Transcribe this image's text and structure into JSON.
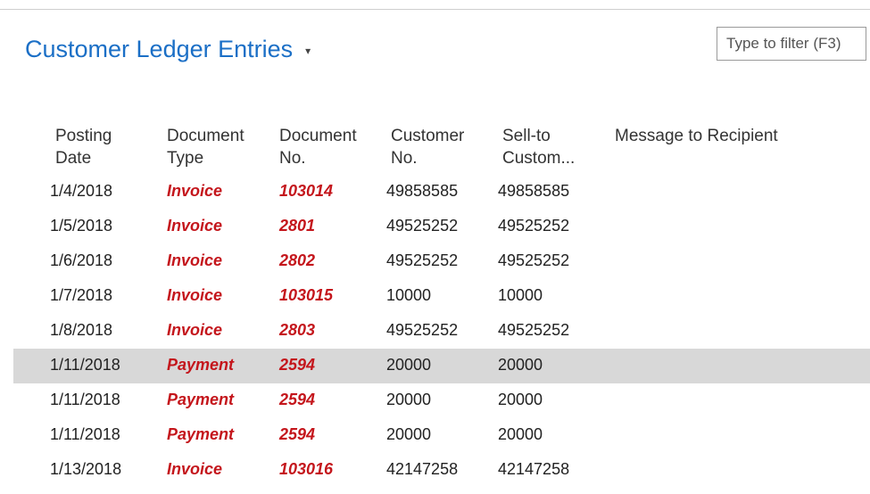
{
  "page": {
    "title": "Customer Ledger Entries",
    "title_dropdown_icon": "chevron-down-icon",
    "filter_placeholder": "Type to filter (F3)"
  },
  "table": {
    "columns": [
      {
        "key": "posting_date",
        "label": "Posting\nDate"
      },
      {
        "key": "document_type",
        "label": "Document\nType"
      },
      {
        "key": "document_no",
        "label": "Document\nNo."
      },
      {
        "key": "customer_no",
        "label": "Customer\nNo."
      },
      {
        "key": "sell_to",
        "label": "Sell-to\nCustom..."
      },
      {
        "key": "message",
        "label": "Message to Recipient"
      }
    ],
    "rows": [
      {
        "posting_date": "1/4/2018",
        "document_type": "Invoice",
        "document_no": "103014",
        "customer_no": "49858585",
        "sell_to": "49858585",
        "message": "",
        "selected": false
      },
      {
        "posting_date": "1/5/2018",
        "document_type": "Invoice",
        "document_no": "2801",
        "customer_no": "49525252",
        "sell_to": "49525252",
        "message": "",
        "selected": false
      },
      {
        "posting_date": "1/6/2018",
        "document_type": "Invoice",
        "document_no": "2802",
        "customer_no": "49525252",
        "sell_to": "49525252",
        "message": "",
        "selected": false
      },
      {
        "posting_date": "1/7/2018",
        "document_type": "Invoice",
        "document_no": "103015",
        "customer_no": "10000",
        "sell_to": "10000",
        "message": "",
        "selected": false
      },
      {
        "posting_date": "1/8/2018",
        "document_type": "Invoice",
        "document_no": "2803",
        "customer_no": "49525252",
        "sell_to": "49525252",
        "message": "",
        "selected": false
      },
      {
        "posting_date": "1/11/2018",
        "document_type": "Payment",
        "document_no": "2594",
        "customer_no": "20000",
        "sell_to": "20000",
        "message": "",
        "selected": true
      },
      {
        "posting_date": "1/11/2018",
        "document_type": "Payment",
        "document_no": "2594",
        "customer_no": "20000",
        "sell_to": "20000",
        "message": "",
        "selected": false
      },
      {
        "posting_date": "1/11/2018",
        "document_type": "Payment",
        "document_no": "2594",
        "customer_no": "20000",
        "sell_to": "20000",
        "message": "",
        "selected": false
      },
      {
        "posting_date": "1/13/2018",
        "document_type": "Invoice",
        "document_no": "103016",
        "customer_no": "42147258",
        "sell_to": "42147258",
        "message": "",
        "selected": false
      }
    ]
  },
  "colors": {
    "title": "#1b6fc6",
    "link_red": "#c4161c",
    "selected_row": "#d8d8d8"
  }
}
